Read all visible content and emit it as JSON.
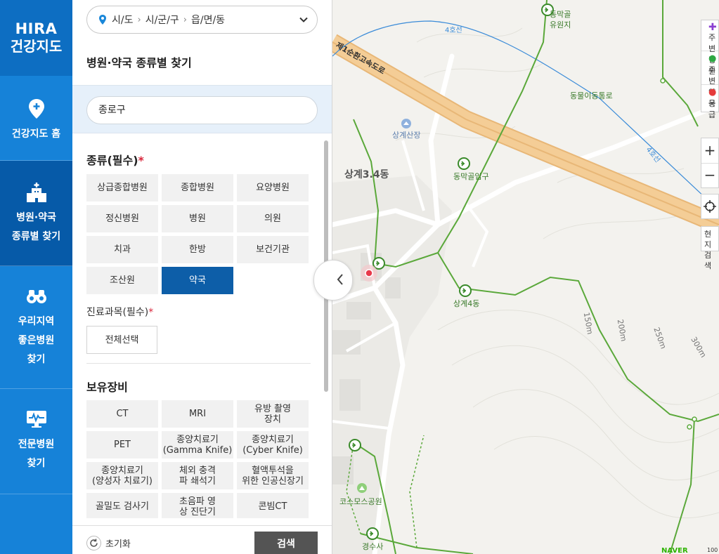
{
  "logo": {
    "line1": "HIRA",
    "line2": "건강지도"
  },
  "nav": [
    {
      "id": "home",
      "label": "건강지도 홈",
      "icon": "location-pin-icon"
    },
    {
      "id": "type-search",
      "label1": "병원·약국",
      "label2": "종류별 찾기",
      "icon": "hospital-building-icon",
      "active": true
    },
    {
      "id": "good-hospital",
      "label1": "우리지역",
      "label2": "좋은병원",
      "label3": "찾기",
      "icon": "binoculars-icon"
    },
    {
      "id": "specialty",
      "label1": "전문병원",
      "label2": "찾기",
      "icon": "monitor-heartbeat-icon"
    }
  ],
  "region": {
    "sido": "시/도",
    "sigungu": "시/군/구",
    "dong": "읍/면/동"
  },
  "panel_title": "병원·약국 종류별 찾기",
  "search_value": "종로구",
  "type_section": {
    "title": "종류(필수)",
    "required_mark": "*",
    "options": [
      "상급종합병원",
      "종합병원",
      "요양병원",
      "정신병원",
      "병원",
      "의원",
      "치과",
      "한방",
      "보건기관",
      "조산원",
      "약국"
    ],
    "selected": "약국"
  },
  "dept_section": {
    "title": "진료과목(필수)",
    "required_mark": "*",
    "option": "전체선택"
  },
  "equip_section": {
    "title": "보유장비",
    "options": [
      [
        "CT"
      ],
      [
        "MRI"
      ],
      [
        "유방 촬영",
        "장치"
      ],
      [
        "PET"
      ],
      [
        "종양치료기",
        "(Gamma Knife)"
      ],
      [
        "종양치료기",
        "(Cyber Knife)"
      ],
      [
        "종양치료기",
        "(양성자 치료기)"
      ],
      [
        "체외 충격",
        "파 쇄석기"
      ],
      [
        "혈액투석을",
        "위한 인공신장기"
      ],
      [
        "골밀도 검사기"
      ],
      [
        "초음파 영",
        "상 진단기"
      ],
      [
        "콘빔CT"
      ]
    ]
  },
  "footer": {
    "reset": "초기화",
    "search": "검색"
  },
  "map": {
    "labels": {
      "road": "제1순환고속도로",
      "line4a": "4호선",
      "line4b": "4호선",
      "dongmak1": "동막골",
      "dongmak2": "유원지",
      "dongmak_entrance": "동막골입구",
      "trail": "동물이동통로",
      "sanggye_sanjang": "상계산장",
      "sanggye34": "상계3.4동",
      "sanggye4": "상계4동",
      "cosmos_park": "코스모스공원",
      "gyeongsusa": "경수사",
      "contour150": "150m",
      "contour200": "200m",
      "contour250": "250m",
      "contour300": "300m",
      "naver": "NAVER",
      "scale": "100"
    },
    "controls": {
      "nearby_hospital1": "주변",
      "nearby_hospital2": "병원",
      "nearby_pharmacy1": "주변",
      "nearby_pharmacy2": "약국",
      "emergency": "응급",
      "current1": "현지",
      "current2": "검색"
    },
    "colors": {
      "route_green": "#5aa83a",
      "highway": "#f0c58a",
      "subway": "#3a8bd8"
    }
  }
}
